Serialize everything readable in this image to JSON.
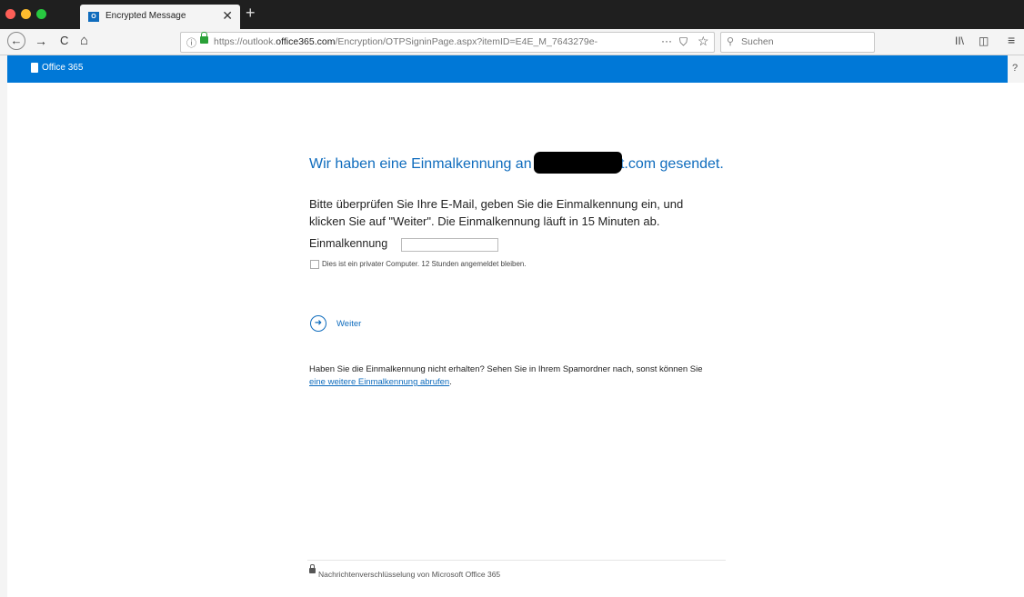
{
  "browser": {
    "tab_title": "Encrypted Message",
    "tab_close": "✕",
    "new_tab": "+",
    "url_prefix": "https://outlook.",
    "url_domain": "office365.com",
    "url_rest": "/Encryption/OTPSigninPage.aspx?itemID=E4E_M_7643279e-",
    "search_placeholder": "Suchen",
    "back_glyph": "←",
    "forward_glyph": "→",
    "reload_glyph": "C",
    "home_glyph": "⌂",
    "more_glyph": "···",
    "library_glyph": "II\\",
    "sidebar_glyph": "◫",
    "menu_glyph": "≡"
  },
  "office_bar": {
    "brand": "Office 365",
    "help": "?"
  },
  "content": {
    "headline_start": "Wir haben eine Einmalkennung an ",
    "headline_visible_fragment": "o",
    "headline_end": "t.com gesendet.",
    "instructions": "Bitte überprüfen Sie Ihre E-Mail, geben Sie die Einmalkennung ein, und klicken Sie auf \"Weiter\". Die Einmalkennung läuft in 15 Minuten ab.",
    "otp_label": "Einmalkennung",
    "otp_value": "",
    "remember_label": "Dies ist ein privater Computer. 12 Stunden angemeldet bleiben.",
    "remember_checked": false,
    "weiter_label": "Weiter",
    "help_text": "Haben Sie die Einmalkennung nicht erhalten? Sehen Sie in Ihrem Spamordner nach, sonst können Sie ",
    "help_link": "eine weitere Einmalkennung abrufen",
    "help_end": "."
  },
  "footer": {
    "text": "Nachrichtenverschlüsselung von Microsoft Office 365"
  },
  "colors": {
    "office_blue": "#0078d7",
    "link_blue": "#0f6cbd",
    "lock_green": "#2aa138"
  }
}
